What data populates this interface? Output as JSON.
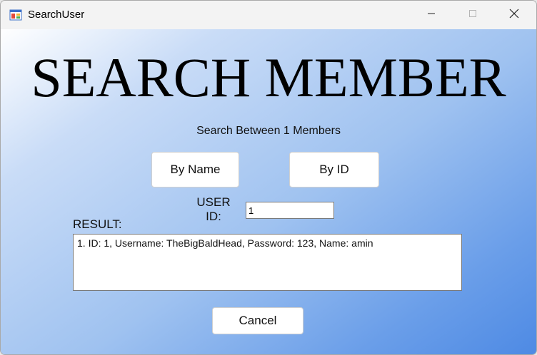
{
  "window": {
    "title": "SearchUser",
    "icon": "winforms-app-icon",
    "controls": [
      "minimize-icon",
      "maximize-icon",
      "close-icon"
    ]
  },
  "form": {
    "heading": "SEARCH MEMBER",
    "subtitle": "Search Between 1 Members",
    "by_name_label": "By Name",
    "by_id_label": "By ID",
    "user_id_label": "USER ID:",
    "user_id_value": "1",
    "result_label": "RESULT:",
    "results": [
      "1. ID: 1, Username: TheBigBaldHead, Password: 123, Name: amin"
    ],
    "cancel_label": "Cancel"
  },
  "colors": {
    "gradient_start": "#ffffff",
    "gradient_end": "#4e8ae4",
    "titlebar": "#f3f3f3"
  }
}
